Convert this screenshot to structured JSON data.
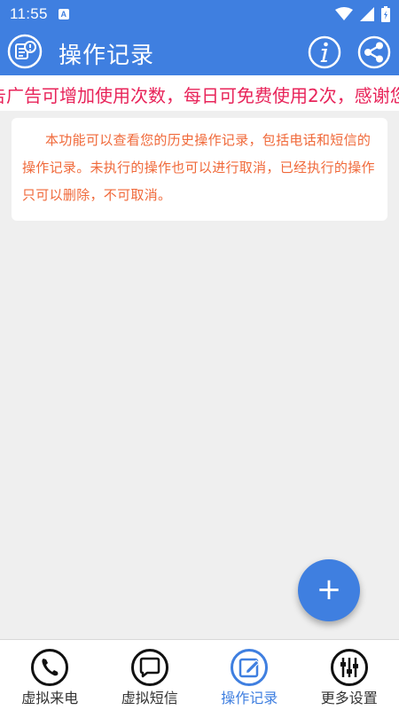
{
  "status_bar": {
    "time": "11:55",
    "notification_icon": "A"
  },
  "app_bar": {
    "title": "操作记录"
  },
  "marquee": {
    "text": "告广告可增加使用次数，每日可免费使用2次，感谢您"
  },
  "notice": {
    "text": "本功能可以查看您的历史操作记录，包括电话和短信的操作记录。未执行的操作也可以进行取消，已经执行的操作只可以删除，不可取消。"
  },
  "fab": {
    "label": "+"
  },
  "bottom_nav": {
    "items": [
      {
        "label": "虚拟来电",
        "icon": "phone-icon"
      },
      {
        "label": "虚拟短信",
        "icon": "message-icon"
      },
      {
        "label": "操作记录",
        "icon": "edit-record-icon",
        "active": true
      },
      {
        "label": "更多设置",
        "icon": "sliders-icon"
      }
    ]
  },
  "colors": {
    "primary": "#3f7fe0",
    "marquee_text": "#e8245a",
    "notice_text": "#f0693a",
    "background": "#efefef"
  }
}
